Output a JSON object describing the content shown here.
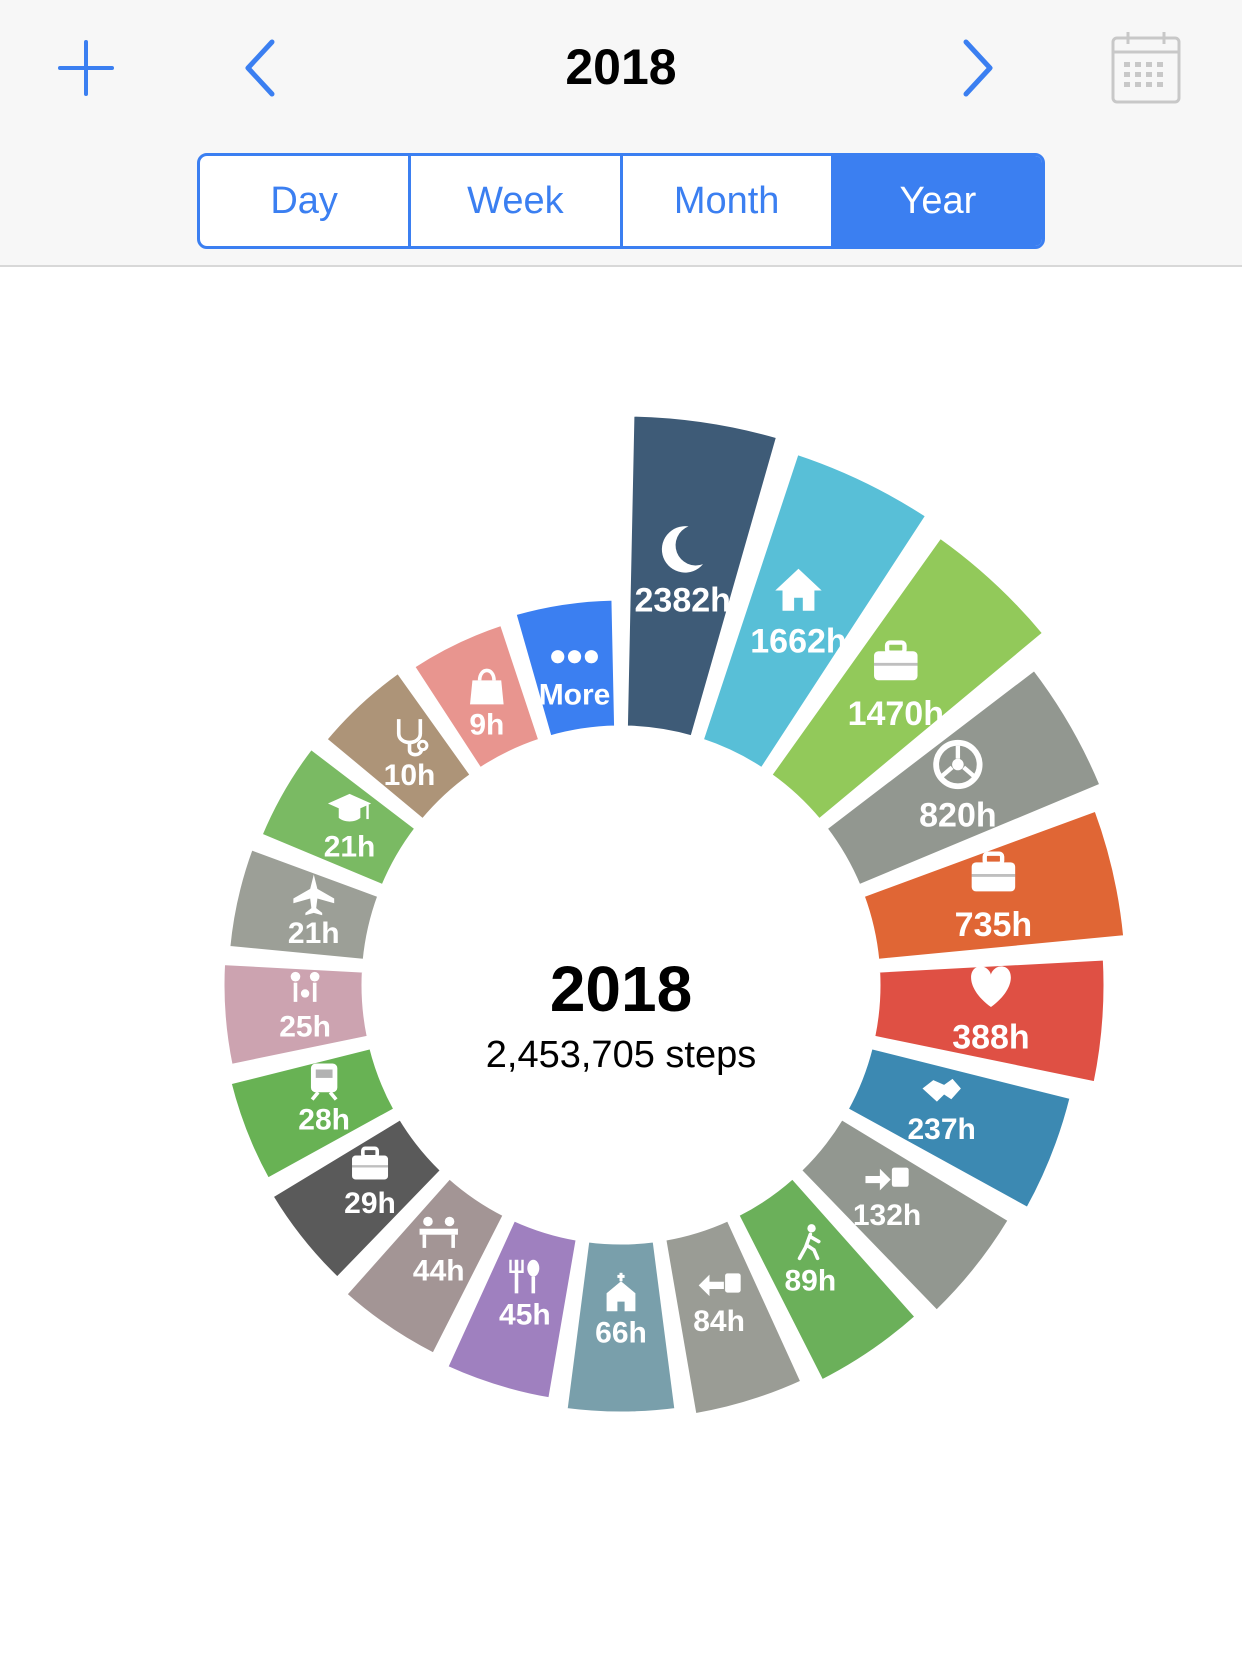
{
  "header": {
    "title": "2018",
    "add_icon": "plus-icon",
    "prev_icon": "chevron-left-icon",
    "next_icon": "chevron-right-icon",
    "calendar_icon": "calendar-icon"
  },
  "tabs": [
    {
      "label": "Day",
      "active": false
    },
    {
      "label": "Week",
      "active": false
    },
    {
      "label": "Month",
      "active": false
    },
    {
      "label": "Year",
      "active": true
    }
  ],
  "center": {
    "title": "2018",
    "subtitle": "2,453,705 steps"
  },
  "colors": {
    "accent": "#3b7ff1",
    "topbar_bg": "#f7f7f7"
  },
  "chart_data": {
    "type": "pie",
    "variant": "radial-donut",
    "segments": [
      {
        "id": "sleep",
        "label": "2382h",
        "value": 2382,
        "color": "#3e5b77",
        "icon": "moon-icon",
        "label_color": "#ffffff"
      },
      {
        "id": "home",
        "label": "1662h",
        "value": 1662,
        "color": "#58bfd7",
        "icon": "house-icon",
        "label_color": "#ffffff"
      },
      {
        "id": "work1",
        "label": "1470h",
        "value": 1470,
        "color": "#92c95a",
        "icon": "briefcase-icon",
        "label_color": "#ffffff"
      },
      {
        "id": "car",
        "label": "820h",
        "value": 820,
        "color": "#929790",
        "icon": "steering-wheel-icon",
        "label_color": "#ffffff"
      },
      {
        "id": "work2",
        "label": "735h",
        "value": 735,
        "color": "#e06635",
        "icon": "briefcase-icon",
        "label_color": "#ffffff"
      },
      {
        "id": "health",
        "label": "388h",
        "value": 388,
        "color": "#df5044",
        "icon": "heart-icon",
        "label_color": "#ffffff"
      },
      {
        "id": "meeting",
        "label": "237h",
        "value": 237,
        "color": "#3c89b2",
        "icon": "handshake-icon",
        "label_color": "#ffffff"
      },
      {
        "id": "commute_in",
        "label": "132h",
        "value": 132,
        "color": "#929790",
        "icon": "arrow-in-briefcase-icon",
        "label_color": "#ffffff"
      },
      {
        "id": "walk",
        "label": "89h",
        "value": 89,
        "color": "#6bb05a",
        "icon": "walking-icon",
        "label_color": "#ffffff"
      },
      {
        "id": "commute_out",
        "label": "84h",
        "value": 84,
        "color": "#9a9c95",
        "icon": "arrow-out-briefcase-icon",
        "label_color": "#ffffff"
      },
      {
        "id": "church",
        "label": "66h",
        "value": 66,
        "color": "#799fab",
        "icon": "church-icon",
        "label_color": "#ffffff"
      },
      {
        "id": "food",
        "label": "45h",
        "value": 45,
        "color": "#9f80bf",
        "icon": "fork-spoon-icon",
        "label_color": "#ffffff"
      },
      {
        "id": "dining",
        "label": "44h",
        "value": 44,
        "color": "#a39595",
        "icon": "dining-people-icon",
        "label_color": "#ffffff"
      },
      {
        "id": "work3",
        "label": "29h",
        "value": 29,
        "color": "#5a5a5a",
        "icon": "briefcase-icon",
        "label_color": "#ffffff"
      },
      {
        "id": "train",
        "label": "28h",
        "value": 28,
        "color": "#68b254",
        "icon": "train-icon",
        "label_color": "#ffffff"
      },
      {
        "id": "family",
        "label": "25h",
        "value": 25,
        "color": "#cca3b0",
        "icon": "family-tree-icon",
        "label_color": "#ffffff"
      },
      {
        "id": "flight",
        "label": "21h",
        "value": 21,
        "color": "#9c9f97",
        "icon": "airplane-icon",
        "label_color": "#ffffff"
      },
      {
        "id": "school",
        "label": "21h",
        "value": 21,
        "color": "#7aba63",
        "icon": "graduation-cap-icon",
        "label_color": "#ffffff"
      },
      {
        "id": "doctor",
        "label": "10h",
        "value": 10,
        "color": "#ad9478",
        "icon": "stethoscope-icon",
        "label_color": "#ffffff"
      },
      {
        "id": "shopping",
        "label": "9h",
        "value": 9,
        "color": "#e8958f",
        "icon": "shopping-bag-icon",
        "label_color": "#ffffff"
      },
      {
        "id": "more",
        "label": "More",
        "value": null,
        "color": "#3b7ff1",
        "icon": "ellipsis-icon",
        "label_color": "#ffffff"
      }
    ]
  }
}
